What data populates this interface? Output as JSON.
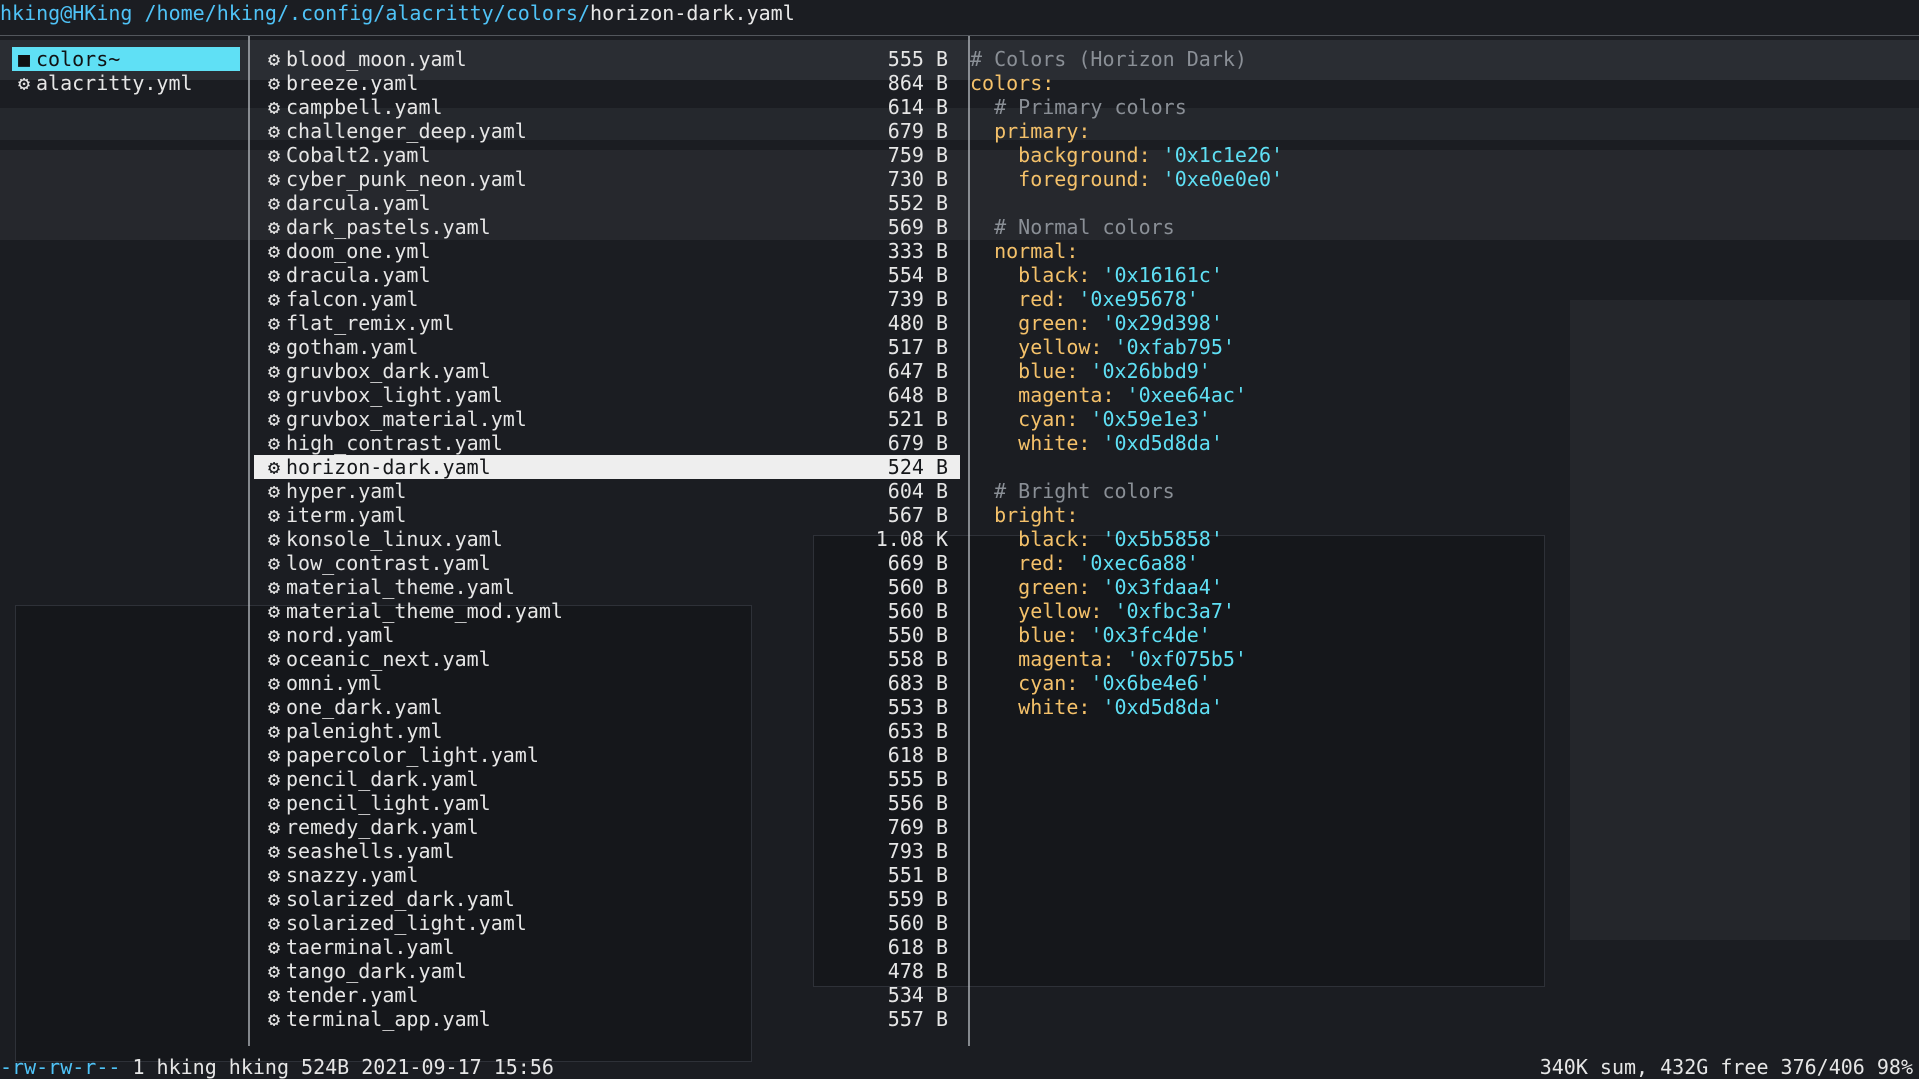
{
  "path_bar": {
    "user_host": "hking@HKing",
    "dir": "/home/hking/.config/alacritty/colors/",
    "file": "horizon-dark.yaml"
  },
  "parent_dir": [
    {
      "icon": "folder-icon",
      "name": "colors~",
      "selected": true
    },
    {
      "icon": "gear-icon",
      "name": "alacritty.yml",
      "selected": false
    }
  ],
  "files": [
    {
      "name": "blood_moon.yaml",
      "size": "555 B"
    },
    {
      "name": "breeze.yaml",
      "size": "864 B"
    },
    {
      "name": "campbell.yaml",
      "size": "614 B"
    },
    {
      "name": "challenger_deep.yaml",
      "size": "679 B"
    },
    {
      "name": "Cobalt2.yaml",
      "size": "759 B"
    },
    {
      "name": "cyber_punk_neon.yaml",
      "size": "730 B"
    },
    {
      "name": "darcula.yaml",
      "size": "552 B"
    },
    {
      "name": "dark_pastels.yaml",
      "size": "569 B"
    },
    {
      "name": "doom_one.yml",
      "size": "333 B"
    },
    {
      "name": "dracula.yaml",
      "size": "554 B"
    },
    {
      "name": "falcon.yaml",
      "size": "739 B"
    },
    {
      "name": "flat_remix.yml",
      "size": "480 B"
    },
    {
      "name": "gotham.yaml",
      "size": "517 B"
    },
    {
      "name": "gruvbox_dark.yaml",
      "size": "647 B"
    },
    {
      "name": "gruvbox_light.yaml",
      "size": "648 B"
    },
    {
      "name": "gruvbox_material.yml",
      "size": "521 B"
    },
    {
      "name": "high_contrast.yaml",
      "size": "679 B"
    },
    {
      "name": "horizon-dark.yaml",
      "size": "524 B",
      "selected": true
    },
    {
      "name": "hyper.yaml",
      "size": "604 B"
    },
    {
      "name": "iterm.yaml",
      "size": "567 B"
    },
    {
      "name": "konsole_linux.yaml",
      "size": "1.08 K"
    },
    {
      "name": "low_contrast.yaml",
      "size": "669 B"
    },
    {
      "name": "material_theme.yaml",
      "size": "560 B"
    },
    {
      "name": "material_theme_mod.yaml",
      "size": "560 B"
    },
    {
      "name": "nord.yaml",
      "size": "550 B"
    },
    {
      "name": "oceanic_next.yaml",
      "size": "558 B"
    },
    {
      "name": "omni.yml",
      "size": "683 B"
    },
    {
      "name": "one_dark.yaml",
      "size": "553 B"
    },
    {
      "name": "palenight.yml",
      "size": "653 B"
    },
    {
      "name": "papercolor_light.yaml",
      "size": "618 B"
    },
    {
      "name": "pencil_dark.yaml",
      "size": "555 B"
    },
    {
      "name": "pencil_light.yaml",
      "size": "556 B"
    },
    {
      "name": "remedy_dark.yaml",
      "size": "769 B"
    },
    {
      "name": "seashells.yaml",
      "size": "793 B"
    },
    {
      "name": "snazzy.yaml",
      "size": "551 B"
    },
    {
      "name": "solarized_dark.yaml",
      "size": "559 B"
    },
    {
      "name": "solarized_light.yaml",
      "size": "560 B"
    },
    {
      "name": "taerminal.yaml",
      "size": "618 B"
    },
    {
      "name": "tango_dark.yaml",
      "size": "478 B"
    },
    {
      "name": "tender.yaml",
      "size": "534 B"
    },
    {
      "name": "terminal_app.yaml",
      "size": "557 B"
    }
  ],
  "preview": [
    {
      "indent": "",
      "comment": "# Colors (Horizon Dark)"
    },
    {
      "indent": "",
      "key": "colors:"
    },
    {
      "indent": "  ",
      "comment": "# Primary colors"
    },
    {
      "indent": "  ",
      "key": "primary:"
    },
    {
      "indent": "    ",
      "key": "background: ",
      "value": "'0x1c1e26'"
    },
    {
      "indent": "    ",
      "key": "foreground: ",
      "value": "'0xe0e0e0'"
    },
    {
      "indent": ""
    },
    {
      "indent": "  ",
      "comment": "# Normal colors"
    },
    {
      "indent": "  ",
      "key": "normal:"
    },
    {
      "indent": "    ",
      "key": "black: ",
      "value": "'0x16161c'"
    },
    {
      "indent": "    ",
      "key": "red: ",
      "value": "'0xe95678'"
    },
    {
      "indent": "    ",
      "key": "green: ",
      "value": "'0x29d398'"
    },
    {
      "indent": "    ",
      "key": "yellow: ",
      "value": "'0xfab795'"
    },
    {
      "indent": "    ",
      "key": "blue: ",
      "value": "'0x26bbd9'"
    },
    {
      "indent": "    ",
      "key": "magenta: ",
      "value": "'0xee64ac'"
    },
    {
      "indent": "    ",
      "key": "cyan: ",
      "value": "'0x59e1e3'"
    },
    {
      "indent": "    ",
      "key": "white: ",
      "value": "'0xd5d8da'"
    },
    {
      "indent": ""
    },
    {
      "indent": "  ",
      "comment": "# Bright colors"
    },
    {
      "indent": "  ",
      "key": "bright:"
    },
    {
      "indent": "    ",
      "key": "black: ",
      "value": "'0x5b5858'"
    },
    {
      "indent": "    ",
      "key": "red: ",
      "value": "'0xec6a88'"
    },
    {
      "indent": "    ",
      "key": "green: ",
      "value": "'0x3fdaa4'"
    },
    {
      "indent": "    ",
      "key": "yellow: ",
      "value": "'0xfbc3a7'"
    },
    {
      "indent": "    ",
      "key": "blue: ",
      "value": "'0x3fc4de'"
    },
    {
      "indent": "    ",
      "key": "magenta: ",
      "value": "'0xf075b5'"
    },
    {
      "indent": "    ",
      "key": "cyan: ",
      "value": "'0x6be4e6'"
    },
    {
      "indent": "    ",
      "key": "white: ",
      "value": "'0xd5d8da'"
    }
  ],
  "status_bar": {
    "permissions": "-rw-rw-r--",
    "info": "1 hking hking 524B 2021-09-17 15:56",
    "summary": "340K sum, 432G free  376/406  98%"
  },
  "colors": {
    "accent_cyan": "#5fe0f5",
    "key_yellow": "#f4c16a",
    "comment_gray": "#8a8f96"
  }
}
